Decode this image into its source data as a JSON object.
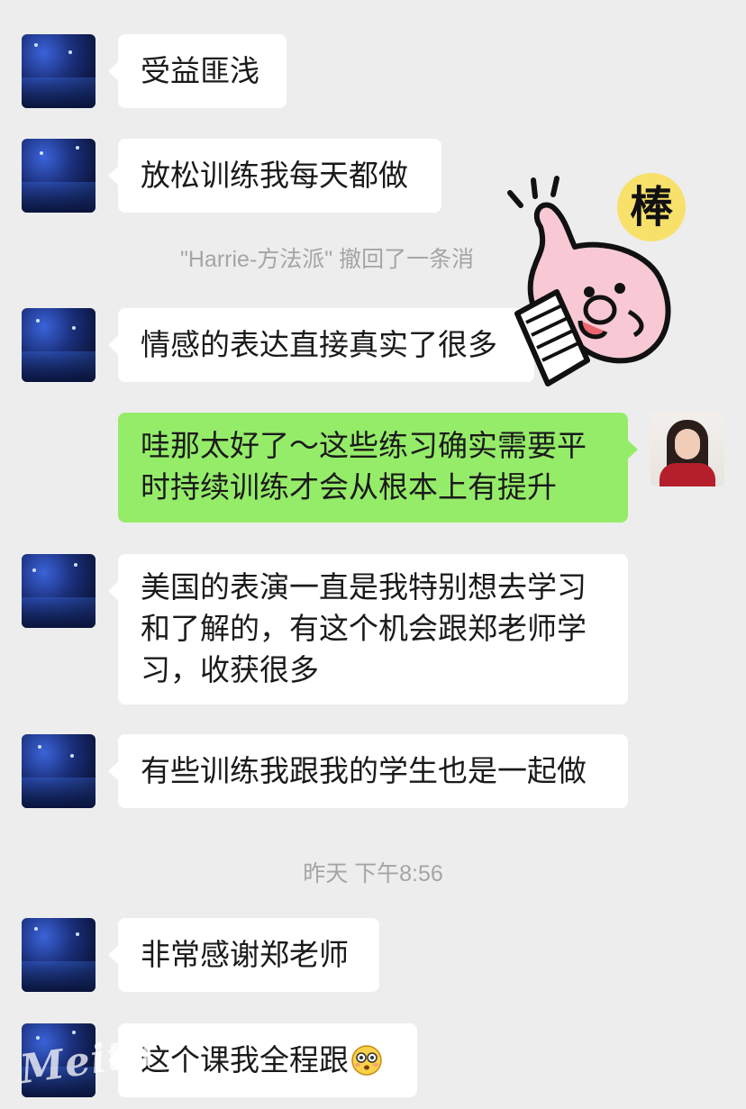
{
  "chat": {
    "messages": [
      {
        "side": "left",
        "text": "受益匪浅"
      },
      {
        "side": "left",
        "text": "放松训练我每天都做"
      },
      {
        "side": "left",
        "text": "情感的表达直接真实了很多"
      },
      {
        "side": "right",
        "text": "哇那太好了～这些练习确实需要平时持续训练才会从根本上有提升"
      },
      {
        "side": "left",
        "text": "美国的表演一直是我特别想去学习和了解的，有这个机会跟郑老师学习，收获很多"
      },
      {
        "side": "left",
        "text": "有些训练我跟我的学生也是一起做"
      },
      {
        "side": "left",
        "text": "非常感谢郑老师"
      },
      {
        "side": "left",
        "text": "这个课我全程跟"
      }
    ],
    "recall_notice": "\"Harrie-方法派\" 撤回了一条消",
    "timestamp": "昨天 下午8:56"
  },
  "sticker": {
    "icon": "thumbs-up-sticker-icon",
    "text": "棒"
  },
  "emoji": {
    "icon": "dizzy-face-emoji-icon"
  },
  "watermark": "Meitu",
  "colors": {
    "background": "#ededed",
    "bubble_left": "#ffffff",
    "bubble_right": "#95ec69",
    "system_text": "#a5a5a5"
  }
}
